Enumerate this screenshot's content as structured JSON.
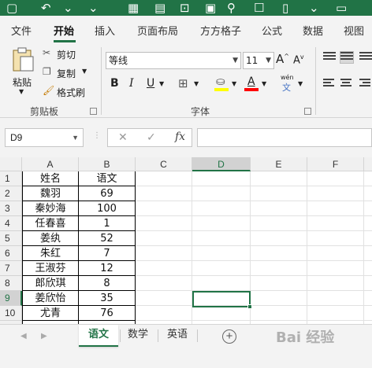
{
  "ribbon_tabs": [
    "文件",
    "开始",
    "插入",
    "页面布局",
    "方方格子",
    "公式",
    "数据",
    "视图"
  ],
  "active_tab": "开始",
  "clipboard": {
    "paste": "粘贴",
    "cut": "剪切",
    "copy": "复制",
    "format_painter": "格式刷",
    "group": "剪贴板"
  },
  "font": {
    "name": "等线",
    "size": "11",
    "grow": "A",
    "shrink": "A",
    "bold": "B",
    "italic": "I",
    "underline": "U",
    "phonetic": "wén",
    "phonetic_char": "文",
    "group": "字体"
  },
  "name_box": "D9",
  "formula_symbol": "fx",
  "columns": [
    "A",
    "B",
    "C",
    "D",
    "E",
    "F"
  ],
  "selected_column": "D",
  "selected_row": "9",
  "rows": [
    {
      "n": "1",
      "a": "姓名",
      "b": "语文"
    },
    {
      "n": "2",
      "a": "魏羽",
      "b": "69"
    },
    {
      "n": "3",
      "a": "秦妙海",
      "b": "100"
    },
    {
      "n": "4",
      "a": "任春喜",
      "b": "1"
    },
    {
      "n": "5",
      "a": "姜纨",
      "b": "52"
    },
    {
      "n": "6",
      "a": "朱红",
      "b": "7"
    },
    {
      "n": "7",
      "a": "王淑芬",
      "b": "12"
    },
    {
      "n": "8",
      "a": "郎欣琪",
      "b": "8"
    },
    {
      "n": "9",
      "a": "姜欣怡",
      "b": "35"
    },
    {
      "n": "10",
      "a": "尤青",
      "b": "76"
    },
    {
      "n": "11",
      "a": "",
      "b": ""
    }
  ],
  "sheet_tabs": [
    "语文",
    "数学",
    "英语"
  ],
  "active_sheet": "语文",
  "watermark": "Bai 经验",
  "colors": {
    "accent": "#217346",
    "ribbon_bg": "#f3f3f3",
    "header_bg": "#f0f0f0"
  }
}
